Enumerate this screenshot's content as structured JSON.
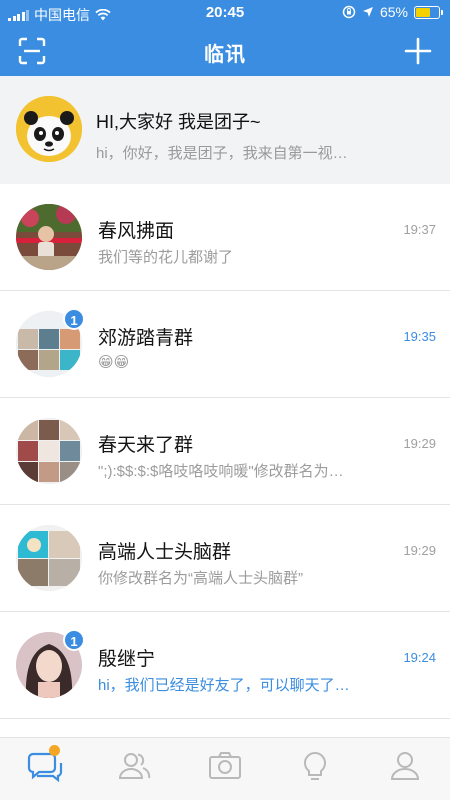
{
  "status_bar": {
    "carrier": "中国电信",
    "time": "20:45",
    "battery": "65%",
    "battery_level": 0.65,
    "battery_color": "#f5d100"
  },
  "header": {
    "title": "临讯",
    "left_icon": "scan-icon",
    "right_icon": "plus-icon",
    "bg_color": "#3a8de0"
  },
  "profile": {
    "name": "HI,大家好  我是团子~",
    "signature": "hi，你好，我是团子，我来自第一视…",
    "avatar": "panda-avatar"
  },
  "chats": [
    {
      "name": "春风拂面",
      "message": "我们等的花儿都谢了",
      "time": "19:37",
      "unread": "",
      "highlight": false
    },
    {
      "name": "郊游踏青群",
      "message": "😁😁",
      "time": "19:35",
      "unread": "1",
      "highlight": true
    },
    {
      "name": "春天来了群",
      "message": "\";):$$:$:$咯吱咯吱响暖\"修改群名为…",
      "time": "19:29",
      "unread": "",
      "highlight": false
    },
    {
      "name": "高端人士头脑群",
      "message": "你修改群名为“高端人士头脑群”",
      "time": "19:29",
      "unread": "",
      "highlight": false
    },
    {
      "name": "殷继宁",
      "message": "hi，我们已经是好友了，可以聊天了…",
      "time": "19:24",
      "unread": "1",
      "highlight": true
    }
  ],
  "tabbar": {
    "items": [
      "messages-icon",
      "contacts-icon",
      "camera-icon",
      "discover-bulb-icon",
      "profile-icon"
    ],
    "active_color": "#3a8de0",
    "inactive_color": "#b9b9b9",
    "dot_color": "#f5a623"
  }
}
